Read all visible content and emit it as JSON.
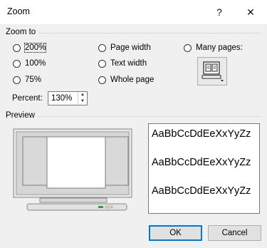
{
  "window": {
    "title": "Zoom",
    "help_glyph": "?",
    "close_glyph": "✕"
  },
  "zoom_to": {
    "label": "Zoom to",
    "options": [
      {
        "label": "200%",
        "selected": false
      },
      {
        "label": "100%",
        "selected": false
      },
      {
        "label": "75%",
        "selected": false
      },
      {
        "label": "Page width",
        "selected": false
      },
      {
        "label": "Text width",
        "selected": false
      },
      {
        "label": "Whole page",
        "selected": false
      },
      {
        "label": "Many pages:",
        "selected": false
      }
    ],
    "many_pages_button_icon": "monitor-pages-icon"
  },
  "percent": {
    "label": "Percent:",
    "value": "130%"
  },
  "preview": {
    "label": "Preview",
    "sample_lines": [
      "AaBbCcDdEeXxYyZz",
      "AaBbCcDdEeXxYyZz",
      "AaBbCcDdEeXxYyZz"
    ]
  },
  "buttons": {
    "ok": "OK",
    "cancel": "Cancel"
  },
  "colors": {
    "dialog_bg": "#f0f0f0",
    "accent": "#0078d7"
  }
}
